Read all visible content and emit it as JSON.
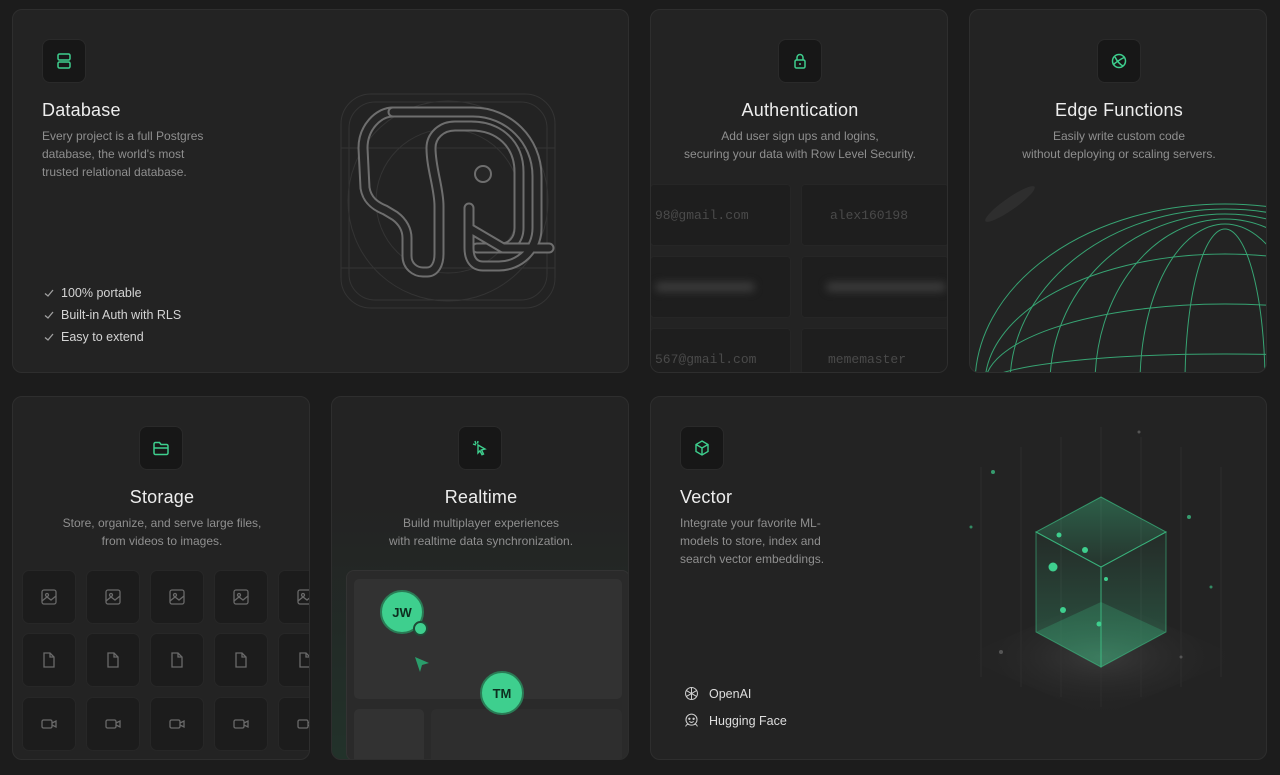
{
  "accent": "#3ecf8e",
  "database": {
    "icon": "database-icon",
    "title": "Database",
    "desc": [
      "Every project is a full Postgres",
      "database, the world's most",
      "trusted relational database."
    ],
    "features": [
      "100% portable",
      "Built-in Auth with RLS",
      "Easy to extend"
    ]
  },
  "auth": {
    "icon": "lock-icon",
    "title": "Authentication",
    "desc": [
      "Add user sign ups and logins,",
      "securing your data with Row Level Security."
    ],
    "rows": [
      [
        "98@gmail.com",
        "alex160198"
      ],
      [
        "",
        ""
      ],
      [
        "567@gmail.com",
        "mememaster"
      ]
    ]
  },
  "edge": {
    "icon": "globe-icon",
    "title": "Edge Functions",
    "desc": [
      "Easily write custom code",
      "without deploying or scaling servers."
    ]
  },
  "storage": {
    "icon": "folder-icon",
    "title": "Storage",
    "desc": [
      "Store, organize, and serve large files,",
      "from videos to images."
    ],
    "rows": [
      "image-icon",
      "file-icon",
      "video-icon"
    ]
  },
  "realtime": {
    "icon": "cursor-icon",
    "title": "Realtime",
    "desc": [
      "Build multiplayer experiences",
      "with realtime data synchronization."
    ],
    "users": [
      "JW",
      "TM"
    ]
  },
  "vector": {
    "icon": "cube-icon",
    "title": "Vector",
    "desc": [
      "Integrate your favorite ML-",
      "models to store, index and",
      "search vector embeddings."
    ],
    "providers": [
      {
        "icon": "openai-icon",
        "label": "OpenAI"
      },
      {
        "icon": "hugging-face-icon",
        "label": "Hugging Face"
      }
    ]
  }
}
